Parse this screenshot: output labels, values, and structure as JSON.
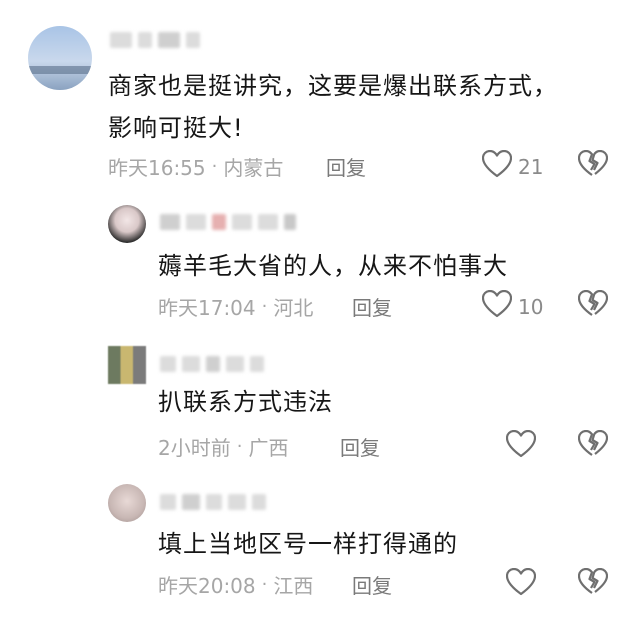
{
  "comments": [
    {
      "text_lines": [
        "商家也是挺讲究，这要是爆出联系方式，",
        "影响可挺大!"
      ],
      "time": "昨天16:55",
      "location": "内蒙古",
      "reply_label": "回复",
      "like_count": "21"
    },
    {
      "text_lines": [
        "薅羊毛大省的人，从来不怕事大"
      ],
      "time": "昨天17:04",
      "location": "河北",
      "reply_label": "回复",
      "like_count": "10"
    },
    {
      "text_lines": [
        "扒联系方式违法"
      ],
      "time": "2小时前",
      "location": "广西",
      "reply_label": "回复",
      "like_count": ""
    },
    {
      "text_lines": [
        "填上当地区号一样打得通的"
      ],
      "time": "昨天20:08",
      "location": "江西",
      "reply_label": "回复",
      "like_count": ""
    }
  ],
  "separator": "·",
  "icons": {
    "like": "heart-outline-icon",
    "dislike": "broken-heart-icon"
  },
  "colors": {
    "text": "#161616",
    "meta": "#a6a6a6",
    "icon": "#6f6f6f"
  }
}
